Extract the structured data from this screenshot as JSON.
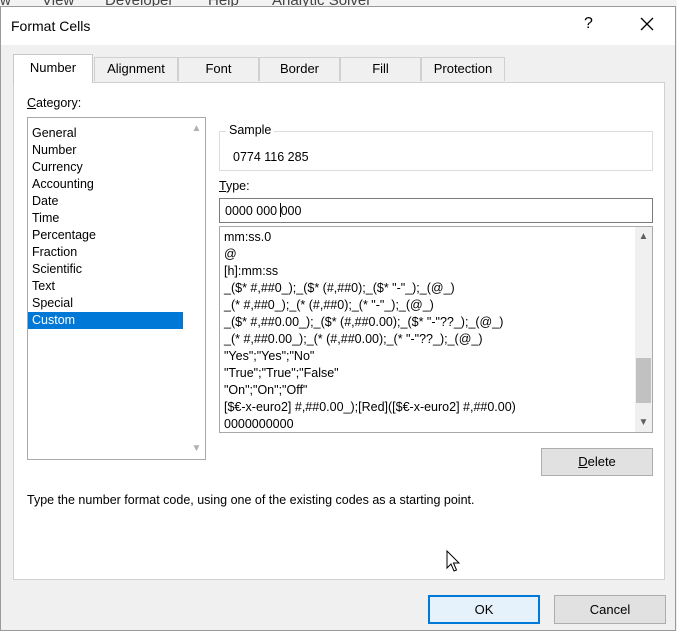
{
  "background_ribbon": [
    "w",
    "View",
    "Developer",
    "Help",
    "Analytic Solver"
  ],
  "dialog": {
    "title": "Format Cells",
    "help_label": "?",
    "icons": {
      "close": "close-icon",
      "cursor": "mouse-pointer-icon",
      "scroll_up": "chevron-up-icon",
      "scroll_down": "chevron-down-icon"
    }
  },
  "tabs": [
    {
      "label": "Number",
      "active": true
    },
    {
      "label": "Alignment"
    },
    {
      "label": "Font"
    },
    {
      "label": "Border"
    },
    {
      "label": "Fill"
    },
    {
      "label": "Protection"
    }
  ],
  "category": {
    "label_prefix": "C",
    "label_rest": "ategory:",
    "items": [
      "General",
      "Number",
      "Currency",
      "Accounting",
      "Date",
      "Time",
      "Percentage",
      "Fraction",
      "Scientific",
      "Text",
      "Special",
      "Custom"
    ],
    "selected": "Custom"
  },
  "sample": {
    "label": "Sample",
    "value": "0774 116 285"
  },
  "type": {
    "label_prefix": "T",
    "label_rest": "ype:",
    "value_before_caret": "0000 000 ",
    "value_after_caret": "000"
  },
  "format_list": [
    "mm:ss.0",
    "@",
    "[h]:mm:ss",
    "_($* #,##0_);_($* (#,##0);_($* \"-\"_);_(@_)",
    "_(* #,##0_);_(* (#,##0);_(* \"-\"_);_(@_)",
    "_($* #,##0.00_);_($* (#,##0.00);_($* \"-\"??_);_(@_)",
    "_(* #,##0.00_);_(* (#,##0.00);_(* \"-\"??_);_(@_)",
    "\"Yes\";\"Yes\";\"No\"",
    "\"True\";\"True\";\"False\"",
    "\"On\";\"On\";\"Off\"",
    "[$€-x-euro2] #,##0.00_);[Red]([$€-x-euro2] #,##0.00)",
    "0000000000"
  ],
  "buttons": {
    "delete_prefix": "D",
    "delete_rest": "elete",
    "ok": "OK",
    "cancel": "Cancel"
  },
  "hint": "Type the number format code, using one of the existing codes as a starting point."
}
